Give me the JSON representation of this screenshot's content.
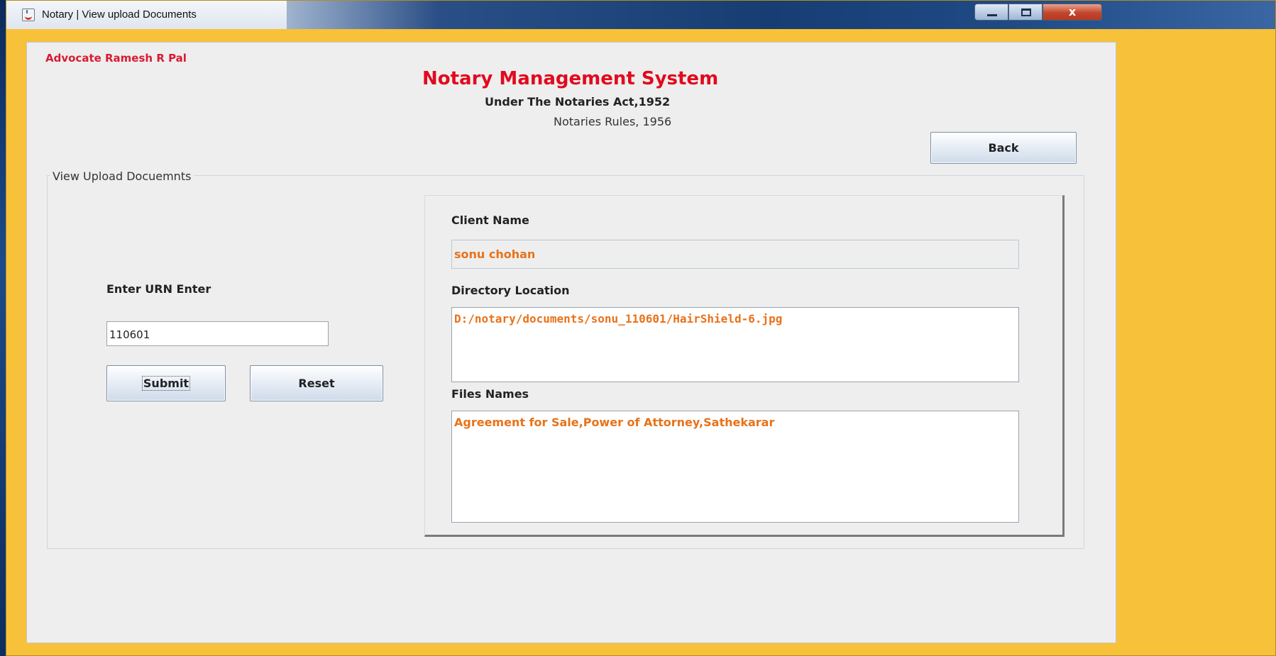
{
  "window": {
    "title": "Notary | View upload Documents",
    "controls": {
      "minimize": "minimize",
      "maximize": "maximize",
      "close": "x"
    }
  },
  "header": {
    "advocate": "Advocate Ramesh R Pal",
    "title": "Notary Management System",
    "subtitle_line1": "Under The Notaries Act,1952",
    "subtitle_line2": "Notaries Rules, 1956",
    "back_label": "Back"
  },
  "group": {
    "label": "View Upload Docuemnts"
  },
  "form": {
    "urn_label": "Enter URN Enter",
    "urn_value": "110601",
    "submit_label": "Submit",
    "reset_label": "Reset"
  },
  "details": {
    "client_label": "Client Name",
    "client_value": "sonu chohan",
    "dir_label": "Directory Location",
    "dir_value": "D:/notary/documents/sonu_110601/HairShield-6.jpg",
    "files_label": "Files Names",
    "files_value": "Agreement for Sale,Power of Attorney,Sathekarar"
  },
  "colors": {
    "accent_red": "#e10a1e",
    "value_orange": "#e8721a",
    "window_frame": "#f7c13a"
  }
}
